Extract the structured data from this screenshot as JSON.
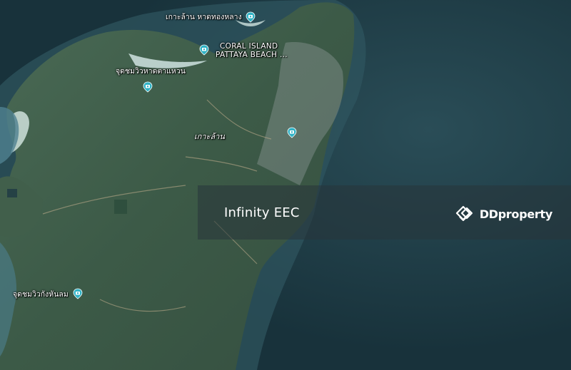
{
  "map": {
    "title": "Infinity EEC",
    "brand": {
      "name": "DDproperty",
      "icon": "ddproperty-logo-icon"
    },
    "colors": {
      "sea_deep": "#1c3b45",
      "sea_shallow": "#3d6b77",
      "land": "#3f5e4a",
      "beach": "#cfe3e0",
      "pin": "#31b3c6"
    },
    "places": [
      {
        "label": "เกาะล้าน หาดทองหลาง",
        "icon": "place-camera-pin-icon"
      },
      {
        "label_line1": "CORAL ISLAND",
        "label_line2": "PATTAYA BEACH ...",
        "icon": "place-camera-pin-icon"
      },
      {
        "label": "จุดชมวิวหาดตาแหวน",
        "icon": "place-camera-pin-icon"
      },
      {
        "label": "",
        "icon": "place-camera-pin-icon"
      },
      {
        "label": "จุดชมวิวกังหันลม",
        "icon": "place-camera-pin-icon"
      }
    ],
    "island_label": "เกาะล้าน"
  }
}
